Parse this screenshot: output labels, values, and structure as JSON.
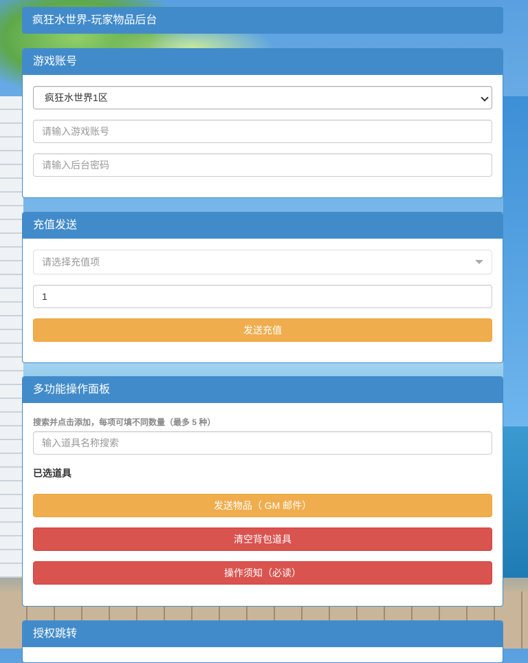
{
  "header": {
    "title": "疯狂水世界-玩家物品后台"
  },
  "account_panel": {
    "title": "游戏账号",
    "server_select": {
      "value": "疯狂水世界1区"
    },
    "account_input": {
      "placeholder": "请输入游戏账号",
      "value": ""
    },
    "password_input": {
      "placeholder": "请输入后台密码",
      "value": ""
    }
  },
  "recharge_panel": {
    "title": "充值发送",
    "item_select": {
      "placeholder": "请选择充值项"
    },
    "quantity_input": {
      "value": "1"
    },
    "send_button": "发送充值"
  },
  "multi_panel": {
    "title": "多功能操作面板",
    "hint": "搜索并点击添加，每项可填不同数量（最多 5 种）",
    "search_input": {
      "placeholder": "输入道具名称搜索"
    },
    "selected_label": "已选道具",
    "send_items_button": "发送物品（ GM 邮件）",
    "clear_bag_button": "清空背包道具",
    "notice_button": "操作须知（必读）"
  },
  "auth_panel": {
    "title": "授权跳转"
  },
  "colors": {
    "primary": "#428bca",
    "warning": "#f0ad4e",
    "danger": "#d9534f"
  }
}
